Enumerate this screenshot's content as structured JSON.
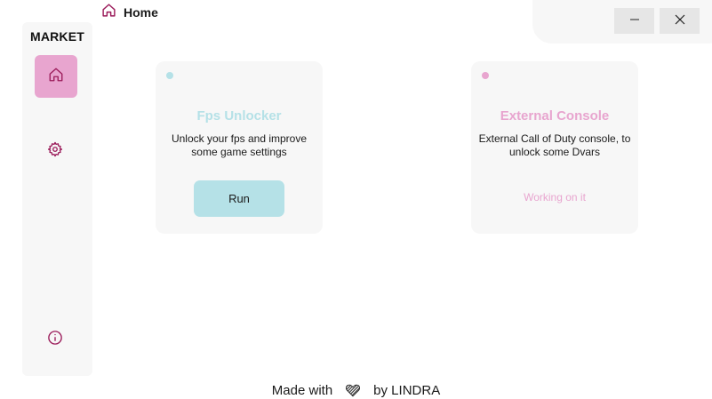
{
  "header": {
    "breadcrumb_label": "Home",
    "breadcrumb_icon": "home-icon"
  },
  "window_controls": {
    "minimize_icon": "minimize-icon",
    "close_icon": "close-icon"
  },
  "sidebar": {
    "brand": "MARKET",
    "items": [
      {
        "id": "home",
        "icon": "home-icon",
        "active": true
      },
      {
        "id": "settings",
        "icon": "gear-icon",
        "active": false
      },
      {
        "id": "info",
        "icon": "info-icon",
        "active": false
      }
    ]
  },
  "cards": [
    {
      "title": "Fps Unlocker",
      "description": "Unlock your fps and improve some game settings",
      "action_label": "Run",
      "accent": "#b5e1e7",
      "title_color": "#b5e1e7"
    },
    {
      "title": "External Console",
      "description": "External Call of Duty console, to unlock some Dvars",
      "status": "Working on it",
      "accent": "#e8a5cf",
      "title_color": "#e8a5cf"
    }
  ],
  "footer": {
    "prefix": "Made with",
    "suffix": "by LINDRA",
    "icon": "heart-icon"
  },
  "colors": {
    "pink_accent": "#e8a5cf",
    "teal_accent": "#b5e1e7",
    "icon_color": "#9b1b5a",
    "panel_bg": "#f7f7f7"
  }
}
